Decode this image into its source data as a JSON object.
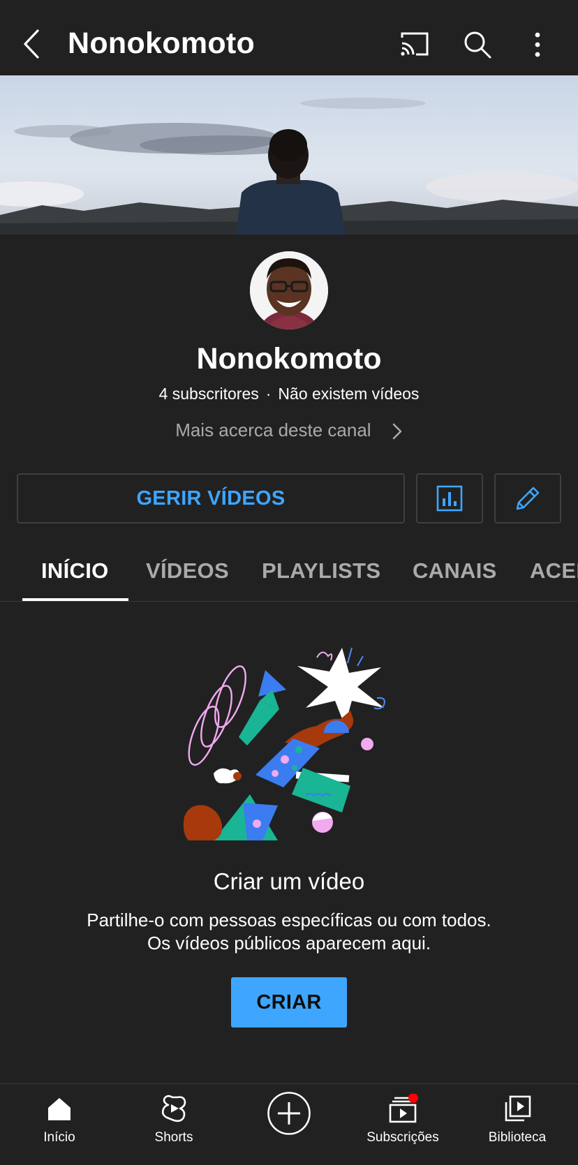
{
  "topbar": {
    "title": "Nonokomoto",
    "icons": [
      "back-icon",
      "cast-icon",
      "search-icon",
      "more-vert-icon"
    ]
  },
  "channel": {
    "name": "Nonokomoto",
    "subscribers": "4 subscritores",
    "separator": "·",
    "videos": "Não existem vídeos",
    "about_link": "Mais acerca deste canal"
  },
  "actions": {
    "manage_videos": "GERIR VÍDEOS",
    "analytics_icon": "analytics-icon",
    "edit_icon": "pencil-icon"
  },
  "tabs": [
    {
      "label": "INÍCIO",
      "active": true
    },
    {
      "label": "VÍDEOS",
      "active": false
    },
    {
      "label": "PLAYLISTS",
      "active": false
    },
    {
      "label": "CANAIS",
      "active": false
    },
    {
      "label": "ACERCA DE",
      "active": false
    }
  ],
  "empty_state": {
    "title": "Criar um vídeo",
    "line1": "Partilhe-o com pessoas específicas ou com todos.",
    "line2": "Os vídeos públicos aparecem aqui.",
    "button": "CRIAR"
  },
  "bottom_nav": {
    "items": [
      {
        "label": "Início",
        "icon": "home-icon"
      },
      {
        "label": "Shorts",
        "icon": "shorts-icon"
      },
      {
        "label": "",
        "icon": "create-plus-icon"
      },
      {
        "label": "Subscrições",
        "icon": "subscriptions-icon",
        "badge": true
      },
      {
        "label": "Biblioteca",
        "icon": "library-icon"
      }
    ]
  },
  "colors": {
    "background": "#212121",
    "accent_blue": "#3ea6ff",
    "muted_text": "#aaaaaa",
    "badge_red": "#ff0000"
  }
}
